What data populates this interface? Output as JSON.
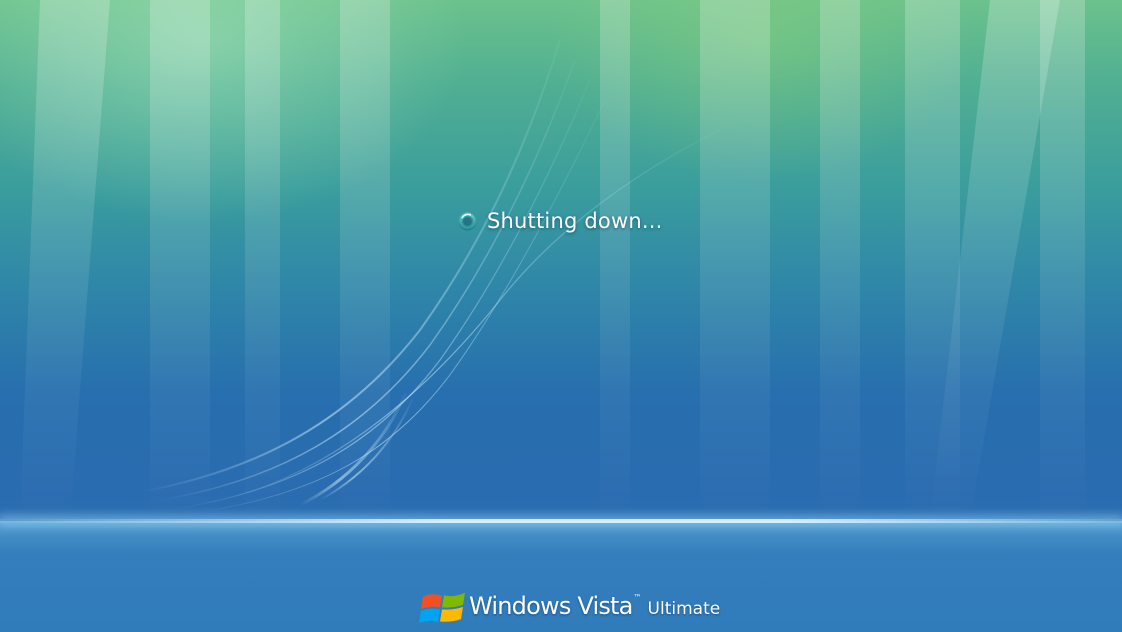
{
  "status": {
    "message": "Shutting down...",
    "icon": "busy-spinner-icon"
  },
  "branding": {
    "logo_icon": "windows-flag-icon",
    "product_name": "Windows Vista",
    "trademark": "™",
    "edition": "Ultimate"
  },
  "colors": {
    "background_top": "#6cc28c",
    "background_mid": "#2f87a8",
    "background_bottom": "#2a6cb0",
    "text": "#ffffff",
    "flag_red": "#f25022",
    "flag_green": "#7fba00",
    "flag_blue": "#00a4ef",
    "flag_yellow": "#ffb900"
  }
}
